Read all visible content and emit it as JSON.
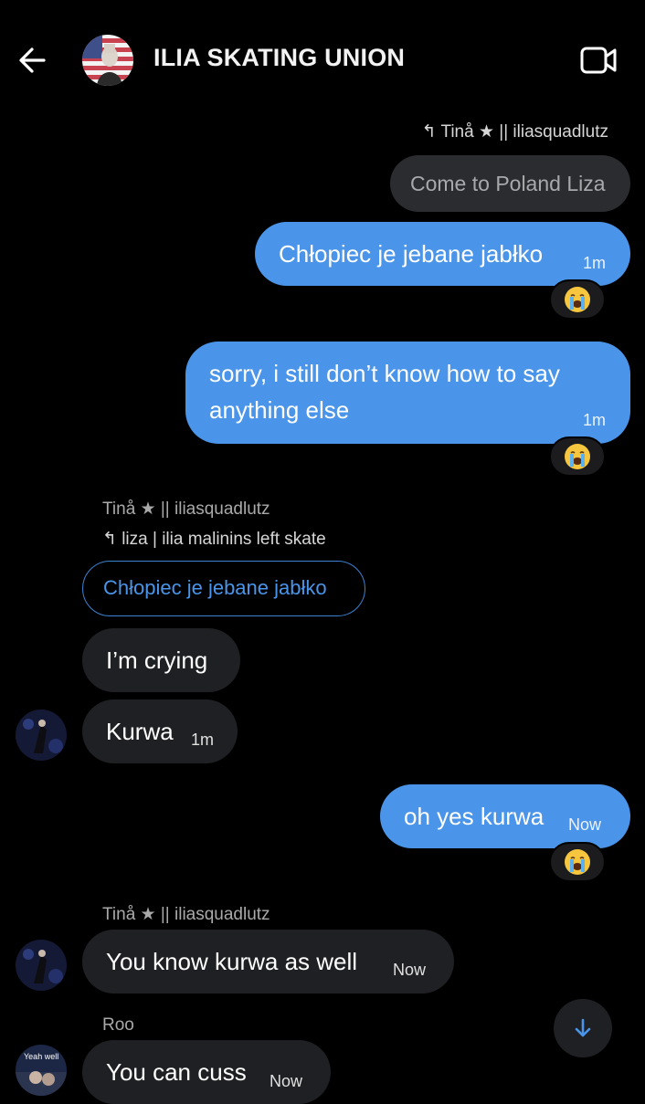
{
  "header": {
    "title": "ILIA SKATING UNION"
  },
  "messages": [
    {
      "reply_meta": "Tinå ★ || iliasquadlutz",
      "quoted": "Come to Poland Liza",
      "text": "Chłopiec je jebane jabłko",
      "time": "1m",
      "reaction": "loudly-crying-emoji"
    },
    {
      "text_line1": "sorry, i still don’t know how to say",
      "text_line2": "anything else",
      "time": "1m",
      "reaction": "loudly-crying-emoji"
    },
    {
      "sender": "Tinå ★ || iliasquadlutz",
      "reply_meta": "liza | ilia malinins left skate",
      "quoted": "Chłopiec je jebane jabłko",
      "text1": "I’m crying",
      "text2": "Kurwa",
      "time": "1m"
    },
    {
      "text": "oh yes kurwa",
      "time": "Now",
      "reaction": "loudly-crying-emoji"
    },
    {
      "sender": "Tinå ★ || iliasquadlutz",
      "text": "You know kurwa as well",
      "time": "Now"
    },
    {
      "sender": "Roo",
      "avatar_text": "Yeah well",
      "text": "You can cuss",
      "time": "Now"
    }
  ],
  "colors": {
    "outgoing": "#4a95e9",
    "incoming": "#1f2023",
    "background": "#000000"
  }
}
